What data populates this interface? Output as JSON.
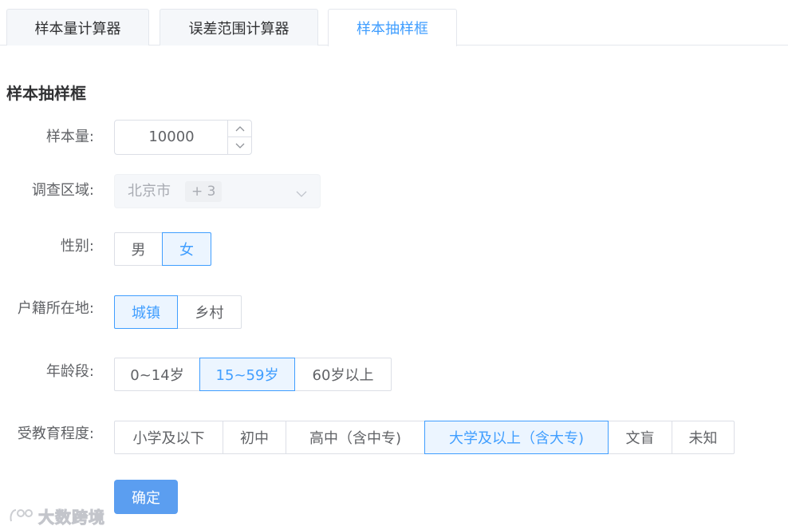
{
  "tabs": [
    {
      "label": "样本量计算器"
    },
    {
      "label": "误差范围计算器"
    },
    {
      "label": "样本抽样框"
    }
  ],
  "section_title": "样本抽样框",
  "form": {
    "sample_size": {
      "label": "样本量:",
      "value": "10000"
    },
    "region": {
      "label": "调查区域:",
      "selected": "北京市",
      "more": "+ 3"
    },
    "gender": {
      "label": "性别:",
      "options": [
        "男",
        "女"
      ],
      "selected": "女"
    },
    "hukou": {
      "label": "户籍所在地:",
      "options": [
        "城镇",
        "乡村"
      ],
      "selected": "城镇"
    },
    "age": {
      "label": "年龄段:",
      "options": [
        "0~14岁",
        "15~59岁",
        "60岁以上"
      ],
      "selected": "15~59岁"
    },
    "education": {
      "label": "受教育程度:",
      "options": [
        "小学及以下",
        "初中",
        "高中（含中专)",
        "大学及以上（含大专)",
        "文盲",
        "未知"
      ],
      "selected": "大学及以上（含大专)"
    }
  },
  "confirm_label": "确定",
  "watermark": "大数跨境",
  "colors": {
    "accent": "#409eff",
    "button": "#5b9ef0",
    "selected_bg": "#ecf5ff"
  }
}
